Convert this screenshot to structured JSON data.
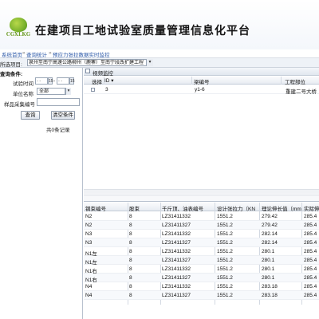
{
  "app": {
    "logo_text": "CGXLKG",
    "title": "在建项目工地试验室质量管理信息化平台"
  },
  "breadcrumb": {
    "items": [
      "系统首页",
      "查询统计",
      "预应力张拉数据实时监控"
    ]
  },
  "project": {
    "label": "所选项目:",
    "value": "泉州至南宁高速公路柳州（鹿寨）至南宁段改扩建工程"
  },
  "filters": {
    "title": "查询条件:",
    "date_label": "试验时间",
    "date_from": "- -",
    "date_to": "- -",
    "unit_label": "单位名称",
    "unit_value": "全部",
    "sample_label": "样品采集编号",
    "sample_value": "",
    "query_button": "查询",
    "clear_button": "清空条件",
    "stats": "共0条记录"
  },
  "video_panel": {
    "title": "视频监控"
  },
  "top_grid": {
    "columns": [
      "选择",
      "ID ▾",
      "梁编号",
      "工程部位"
    ],
    "rows": [
      {
        "id": "3",
        "beam": "y1-6",
        "part": "重建二号大桥"
      }
    ]
  },
  "bottom_grid": {
    "columns": [
      "钢束编号",
      "股束",
      "千斤顶、油表编号",
      "设计张拉力（KN",
      "理论伸长值（mm",
      "实际伸"
    ],
    "rows": [
      [
        "N2",
        "8",
        "LZ31411332",
        "1551.2",
        "279.42",
        "285.4"
      ],
      [
        "N2",
        "8",
        "LZ31411327",
        "1551.2",
        "279.42",
        "285.4"
      ],
      [
        "N3",
        "8",
        "LZ31411332",
        "1551.2",
        "282.14",
        "285.4"
      ],
      [
        "N3",
        "8",
        "LZ31411327",
        "1551.2",
        "282.14",
        "285.4"
      ],
      [
        "N1左",
        "8",
        "LZ31411332",
        "1551.2",
        "280.1",
        "285.4"
      ],
      [
        "N1左",
        "8",
        "LZ31411327",
        "1551.2",
        "280.1",
        "285.4"
      ],
      [
        "N1右",
        "8",
        "LZ31411332",
        "1551.2",
        "280.1",
        "285.4"
      ],
      [
        "N1右",
        "8",
        "LZ31411327",
        "1551.2",
        "280.1",
        "285.4"
      ],
      [
        "N4",
        "8",
        "LZ31411332",
        "1551.2",
        "283.18",
        "285.4"
      ],
      [
        "N4",
        "8",
        "LZ31411327",
        "1551.2",
        "283.18",
        "285.4"
      ]
    ]
  }
}
